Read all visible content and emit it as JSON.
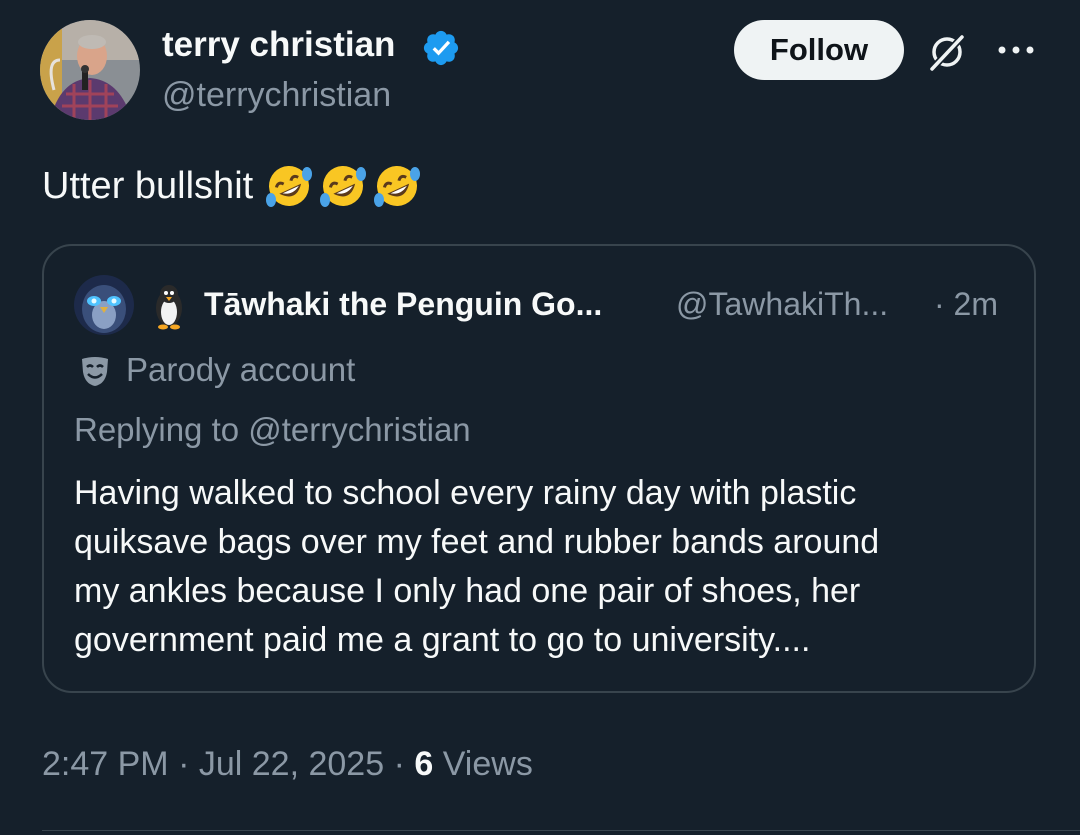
{
  "author": {
    "name": "terry christian",
    "handle": "@terrychristian",
    "verified": true
  },
  "actions": {
    "follow_label": "Follow",
    "grok_icon": "grok-icon",
    "more_icon": "more-icon"
  },
  "tweet": {
    "text": "Utter bullshit",
    "emojis": [
      "rofl-emoji",
      "rofl-emoji",
      "rofl-emoji"
    ]
  },
  "quote": {
    "name": "Tāwhaki the Penguin Go...",
    "handle": "@TawhakiTh...",
    "time": "· 2m",
    "label": "Parody account",
    "replying_to": "Replying to @terrychristian",
    "body_lines": [
      "Having walked to school every rainy day with plastic",
      "quiksave bags over my feet and rubber bands around",
      "my ankles because I only had one pair of shoes, her",
      "government paid me a grant to go to university...."
    ]
  },
  "meta": {
    "time": "2:47 PM",
    "separator": "·",
    "date": "Jul 22, 2025",
    "views_count": "6",
    "views_label": "Views"
  },
  "colors": {
    "background": "#15202b",
    "text": "#f7f9f9",
    "secondary": "#8b98a5",
    "verified": "#1d9bf0",
    "border": "#38444d"
  }
}
